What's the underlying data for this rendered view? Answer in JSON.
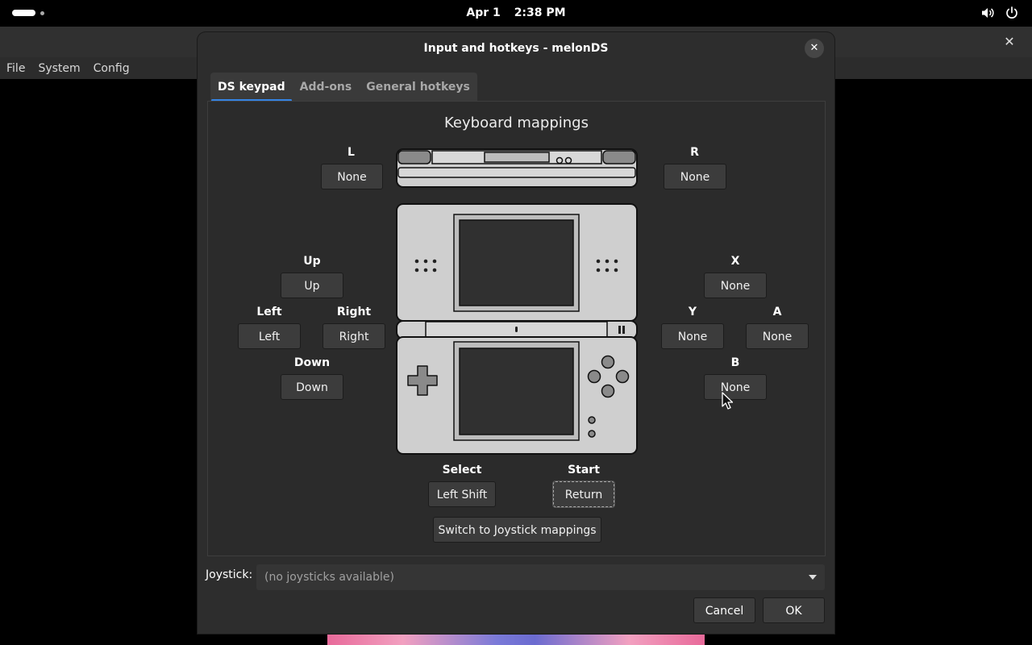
{
  "topbar": {
    "date": "Apr 1",
    "time": "2:38 PM",
    "icons": [
      "volume-icon",
      "power-icon"
    ]
  },
  "background_app": {
    "menu": [
      "File",
      "System",
      "Config"
    ],
    "close_glyph": "✕"
  },
  "dialog": {
    "title": "Input and hotkeys - melonDS",
    "close_glyph": "✕",
    "tabs": [
      {
        "label": "DS keypad",
        "active": true
      },
      {
        "label": "Add-ons",
        "active": false
      },
      {
        "label": "General hotkeys",
        "active": false
      }
    ],
    "section_title": "Keyboard mappings",
    "mappings": {
      "L": {
        "label": "L",
        "value": "None"
      },
      "R": {
        "label": "R",
        "value": "None"
      },
      "Up": {
        "label": "Up",
        "value": "Up"
      },
      "Left": {
        "label": "Left",
        "value": "Left"
      },
      "Right": {
        "label": "Right",
        "value": "Right"
      },
      "Down": {
        "label": "Down",
        "value": "Down"
      },
      "X": {
        "label": "X",
        "value": "None"
      },
      "Y": {
        "label": "Y",
        "value": "None"
      },
      "A": {
        "label": "A",
        "value": "None"
      },
      "B": {
        "label": "B",
        "value": "None"
      },
      "Select": {
        "label": "Select",
        "value": "Left Shift"
      },
      "Start": {
        "label": "Start",
        "value": "Return"
      }
    },
    "switch_button": "Switch to Joystick mappings",
    "joystick_label": "Joystick:",
    "joystick_value": "(no joysticks available)",
    "cancel": "Cancel",
    "ok": "OK"
  },
  "colors": {
    "accent": "#3584e4",
    "dialog_bg": "#2d2d2d",
    "button_bg": "#3c3c3c"
  }
}
